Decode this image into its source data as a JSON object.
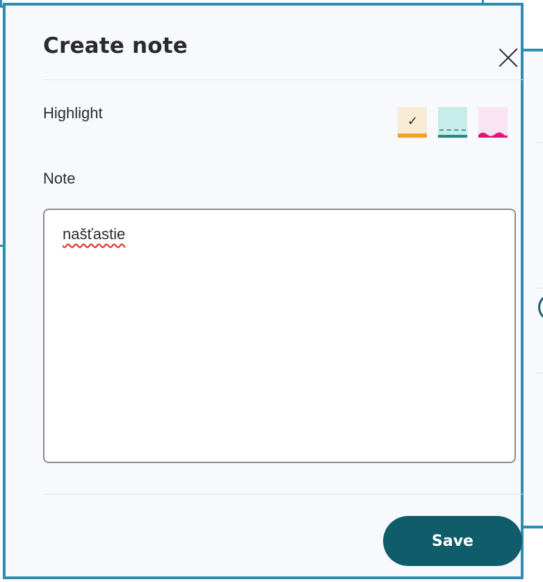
{
  "modal": {
    "title": "Create note",
    "highlight_label": "Highlight",
    "note_label": "Note",
    "note_value": "našťastie",
    "save_label": "Save",
    "highlight_colors": [
      {
        "name": "yellow",
        "color": "#f0a32a",
        "selected": true
      },
      {
        "name": "teal",
        "color": "#1f8a7f",
        "selected": false
      },
      {
        "name": "pink",
        "color": "#e0147a",
        "selected": false
      }
    ],
    "check_mark": "✓"
  }
}
